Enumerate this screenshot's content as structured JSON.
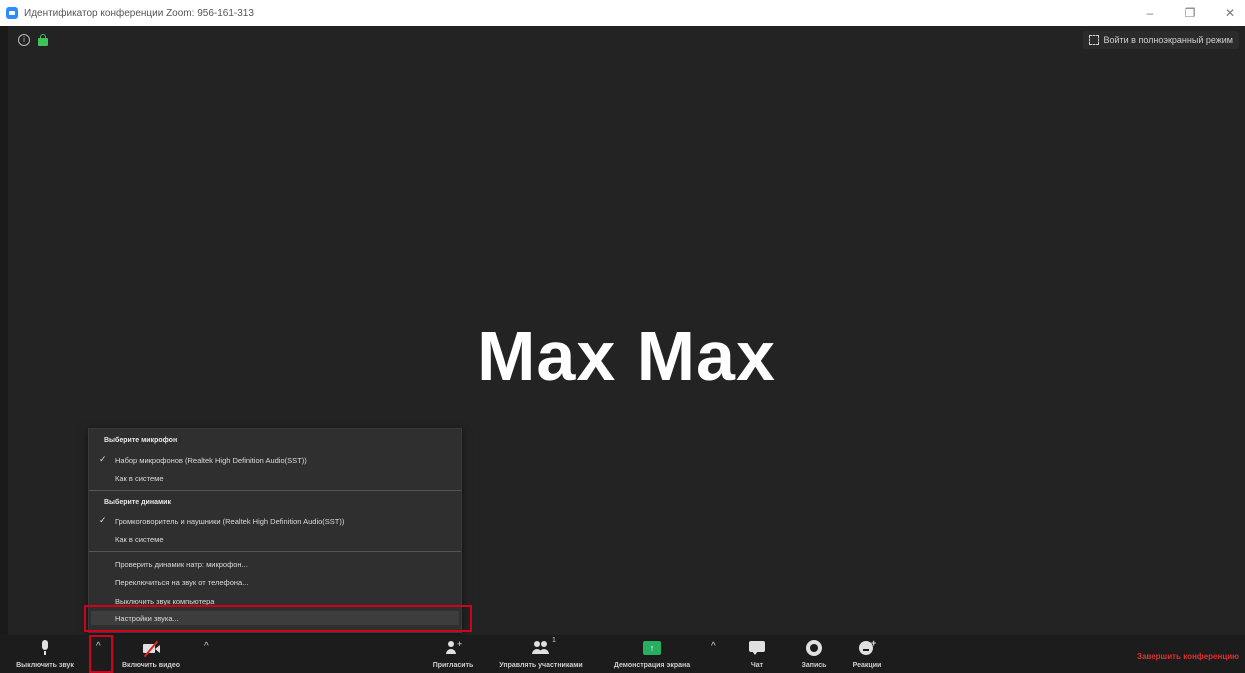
{
  "window": {
    "title": "Идентификатор конференции Zoom: 956-161-313",
    "controls": [
      "–",
      "❐",
      "✕"
    ]
  },
  "stage": {
    "fullscreen_label": "Войти в полноэкранный режим",
    "participant_name": "Max Max",
    "info_icon": "i"
  },
  "audio_menu": {
    "mic_header": "Выберите микрофон",
    "mic_items": [
      "Набор микрофонов (Realtek High Definition Audio(SST))",
      "Как в системе"
    ],
    "speaker_header": "Выберите динамик",
    "speaker_items": [
      "Громкоговоритель и наушники (Realtek High Definition Audio(SST))",
      "Как в системе"
    ],
    "actions": [
      "Проверить динамик натр: микрофон...",
      "Переключиться на звук от телефона...",
      "Выключить звук компьютера",
      "Настройки звука..."
    ],
    "check": "✓"
  },
  "toolbar": {
    "mute_label": "Выключить звук",
    "video_label": "Включить видео",
    "invite_label": "Пригласить",
    "participants_label": "Управлять участниками",
    "participants_count": "1",
    "share_label": "Демонстрация экрана",
    "chat_label": "Чат",
    "record_label": "Запись",
    "reactions_label": "Реакции",
    "end_label": "Завершить конференцию",
    "caret": "^",
    "share_arrow": "↑",
    "react_plus": "+"
  },
  "colors": {
    "accent_green": "#27ae60",
    "end_red": "#e02f2f",
    "highlight_red": "#d0021b"
  }
}
